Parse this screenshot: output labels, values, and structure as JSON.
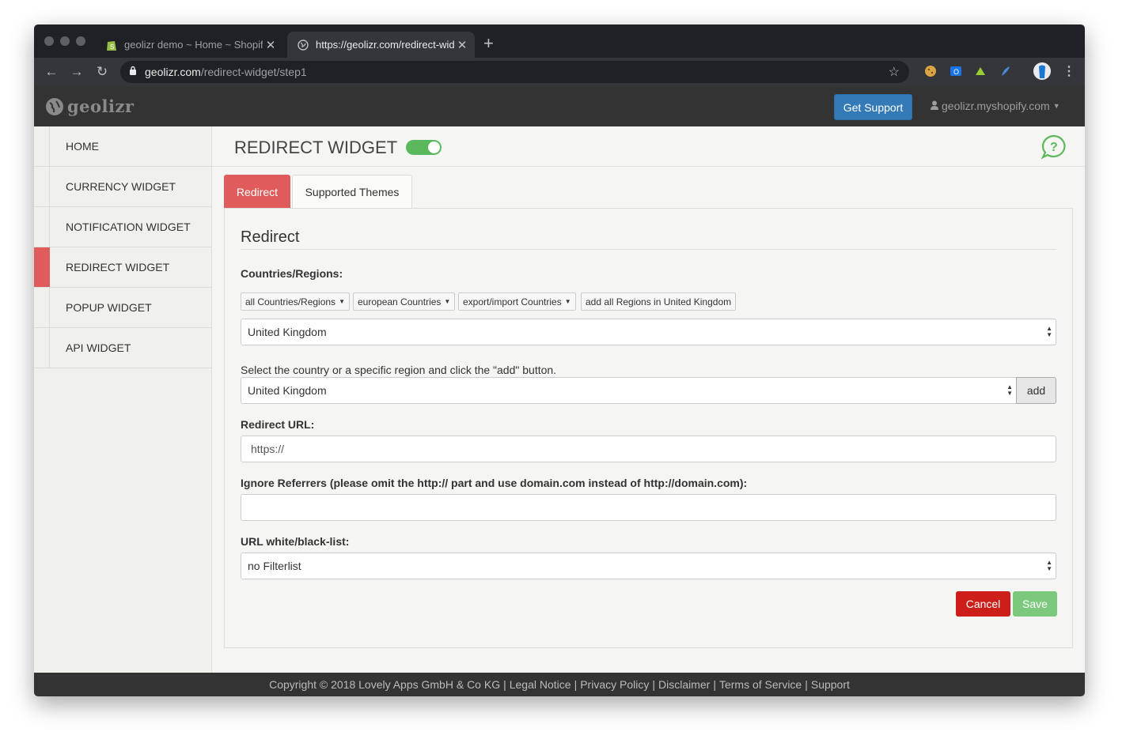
{
  "browser": {
    "tabs": [
      {
        "title": "geolizr demo ~ Home ~ Shopify",
        "favicon": "shopify-icon"
      },
      {
        "title": "https://geolizr.com/redirect-widget/step1",
        "favicon": "globe-icon"
      }
    ],
    "new_tab_label": "+",
    "url_host": "geolizr.com",
    "url_path": "/redirect-widget/step1"
  },
  "header": {
    "logo_text": "geolizr",
    "support_label": "Get Support",
    "account": "geolizr.myshopify.com"
  },
  "sidebar": {
    "items": [
      {
        "label": "HOME"
      },
      {
        "label": "CURRENCY WIDGET"
      },
      {
        "label": "NOTIFICATION WIDGET"
      },
      {
        "label": "REDIRECT WIDGET",
        "active": true
      },
      {
        "label": "POPUP WIDGET"
      },
      {
        "label": "API WIDGET"
      }
    ]
  },
  "page": {
    "title": "REDIRECT WIDGET",
    "enabled": true,
    "tabs": [
      {
        "label": "Redirect",
        "active": true
      },
      {
        "label": "Supported Themes"
      }
    ]
  },
  "form": {
    "heading": "Redirect",
    "countries_label": "Countries/Regions:",
    "quick_buttons": [
      {
        "label": "all Countries/Regions",
        "dropdown": true
      },
      {
        "label": "european Countries",
        "dropdown": true
      },
      {
        "label": "export/import Countries",
        "dropdown": true
      },
      {
        "label": "add all Regions in United Kingdom",
        "dropdown": false
      }
    ],
    "countries_select_value": "United Kingdom",
    "add_hint": "Select the country or a specific region and click the \"add\" button.",
    "region_select_value": "United Kingdom",
    "add_label": "add",
    "redirect_url_label": "Redirect URL:",
    "redirect_url_placeholder": "https://",
    "ignore_label": "Ignore Referrers (please omit the http:// part and use domain.com instead of http://domain.com):",
    "ignore_value": "",
    "filter_label": "URL white/black-list:",
    "filter_value": "no Filterlist",
    "cancel_label": "Cancel",
    "save_label": "Save"
  },
  "footer": {
    "copyright": "Copyright © 2018 Lovely Apps GmbH & Co KG",
    "links": [
      "Legal Notice",
      "Privacy Policy",
      "Disclaimer",
      "Terms of Service",
      "Support"
    ]
  },
  "colors": {
    "accent_red": "#e05c5c",
    "toggle_green": "#5cb85c",
    "support_blue": "#337ab7",
    "cancel_red": "#cc1f1a",
    "save_green": "#7cc87c"
  }
}
